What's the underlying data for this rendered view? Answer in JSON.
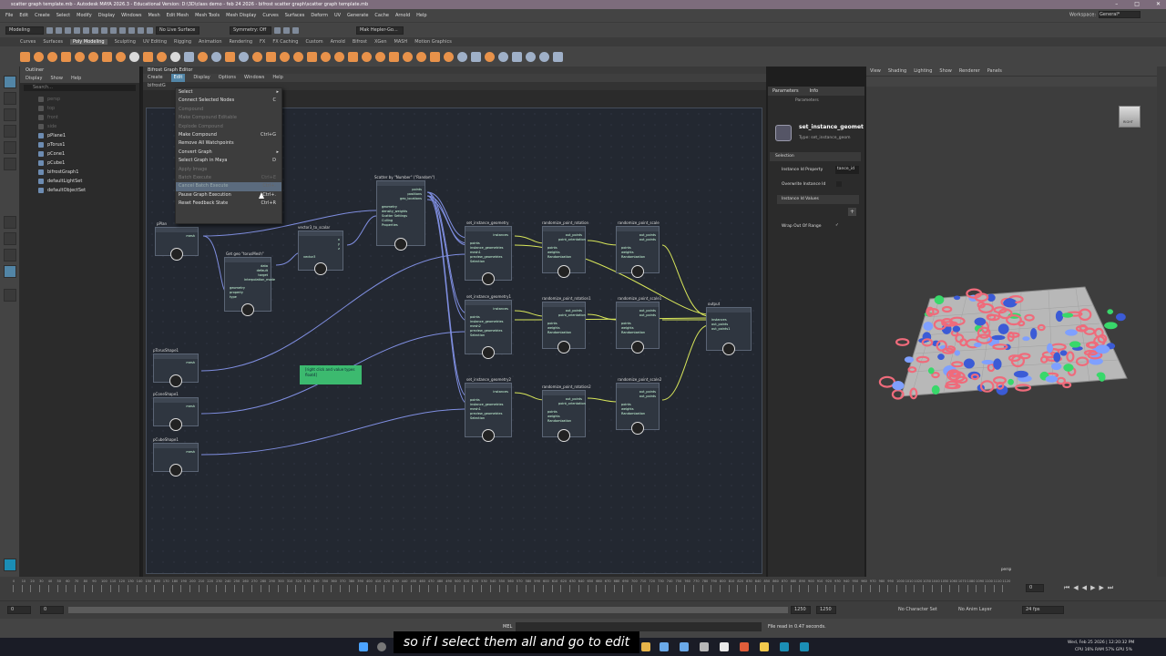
{
  "window": {
    "title": "scatter graph template.mb - Autodesk MAYA 2026.3 - Educational Version: D:\\3D\\class demo - feb 24 2026 - bifrost scatter graph\\scatter graph template.mb"
  },
  "menubar": [
    "File",
    "Edit",
    "Create",
    "Select",
    "Modify",
    "Display",
    "Windows",
    "Mesh",
    "Edit Mesh",
    "Mesh Tools",
    "Mesh Display",
    "Curves",
    "Surfaces",
    "Deform",
    "UV",
    "Generate",
    "Cache",
    "Arnold",
    "Help"
  ],
  "workspace": {
    "label": "Workspace:",
    "value": "General*"
  },
  "statusline": {
    "mode": "Modeling",
    "live_surface": "No Live Surface",
    "symmetry": "Symmetry: Off",
    "user": "Mak Hepler-Go..."
  },
  "shelf_tabs": [
    "Curves",
    "Surfaces",
    "Poly Modeling",
    "Sculpting",
    "UV Editing",
    "Rigging",
    "Animation",
    "Rendering",
    "FX",
    "FX Caching",
    "Custom",
    "Arnold",
    "Bifrost",
    "XGen",
    "MASH",
    "Motion Graphics"
  ],
  "shelf_active": "Poly Modeling",
  "outliner": {
    "title": "Outliner",
    "menu": [
      "Display",
      "Show",
      "Help"
    ],
    "search_placeholder": "Search...",
    "items": [
      {
        "label": "persp",
        "dim": true
      },
      {
        "label": "top",
        "dim": true
      },
      {
        "label": "front",
        "dim": true
      },
      {
        "label": "side",
        "dim": true
      },
      {
        "label": "pPlane1",
        "dim": false
      },
      {
        "label": "pTorus1",
        "dim": false
      },
      {
        "label": "pCone1",
        "dim": false
      },
      {
        "label": "pCube1",
        "dim": false
      },
      {
        "label": "bifrostGraph1",
        "dim": false
      },
      {
        "label": "defaultLightSet",
        "dim": false
      },
      {
        "label": "defaultObjectSet",
        "dim": false
      }
    ]
  },
  "bifrost": {
    "title": "Bifrost Graph Editor",
    "menu": [
      "Create",
      "Edit",
      "Display",
      "Options",
      "Windows",
      "Help"
    ],
    "tab": "bifrostG",
    "edit_menu": [
      {
        "label": "Select",
        "shortcut": "",
        "disabled": false,
        "arrow": true
      },
      {
        "label": "Connect Selected Nodes",
        "shortcut": "C",
        "disabled": false
      },
      {
        "label": "Compound",
        "shortcut": "",
        "disabled": true
      },
      {
        "label": "Make Compound Editable",
        "shortcut": "",
        "disabled": true
      },
      {
        "label": "Explode Compound",
        "shortcut": "",
        "disabled": true
      },
      {
        "label": "Make Compound",
        "shortcut": "Ctrl+G",
        "disabled": false
      },
      {
        "label": "Remove All Watchpoints",
        "shortcut": "",
        "disabled": false
      },
      {
        "label": "Convert Graph",
        "shortcut": "",
        "disabled": false,
        "arrow": true
      },
      {
        "label": "Select Graph in Maya",
        "shortcut": "D",
        "disabled": false
      },
      {
        "label": "Apply Image",
        "shortcut": "",
        "disabled": true
      },
      {
        "label": "Batch Execute",
        "shortcut": "Ctrl+E",
        "disabled": true
      },
      {
        "label": "Cancel Batch Execute",
        "shortcut": "Ctrl+.",
        "disabled": true,
        "highlight": true
      },
      {
        "label": "Pause Graph Execution",
        "shortcut": "Ctrl+.",
        "disabled": false
      },
      {
        "label": "Reset Feedback State",
        "shortcut": "Ctrl+R",
        "disabled": false
      }
    ],
    "note": "[right click and value types float4]",
    "nodes": {
      "pPlane": "pPlan",
      "get_geo": "Get geo \"torusMesh\"",
      "vector3_to_scalar": "vector3_to_scalar",
      "scatter": "Scatter by \"Number\" (\"Random\")",
      "sig0": "set_instance_geometry",
      "sig1": "set_instance_geometry1",
      "sig2": "set_instance_geometry2",
      "rot0": "randomize_point_rotation",
      "rot1": "randomize_point_rotation1",
      "rot2": "randomize_point_rotation2",
      "scl0": "randomize_point_scale",
      "scl1": "randomize_point_scale1",
      "scl2": "randomize_point_scale2",
      "torus": "pTorusShape1",
      "cone": "pConeShape1",
      "cube": "pCubeShape1",
      "output": "output"
    },
    "ports": {
      "mesh": "mesh",
      "scatter_out": [
        "points",
        "positions",
        "geo_locations"
      ],
      "scatter_in": [
        "geometry",
        "density_weights",
        "Scatter Settings",
        "Culling",
        "Properties"
      ],
      "getgeo_out": [
        "data",
        "default",
        "target",
        "interpolation_mode"
      ],
      "getgeo_in": [
        "geometry",
        "property",
        "type"
      ],
      "v3": [
        "x",
        "y",
        "z"
      ],
      "v3_in": "vector3",
      "sig_in": [
        "points",
        "instance_geometries",
        "mesh1",
        "preview_geometries",
        "Selection"
      ],
      "sig_in1": [
        "points",
        "instance_geometries",
        "mesh2",
        "preview_geometries",
        "Selection"
      ],
      "sig_in2": [
        "points",
        "instance_geometries",
        "mesh1",
        "preview_geometries",
        "Selection"
      ],
      "sig_out": "instances",
      "rot_out": [
        "out_points",
        "point_orientation"
      ],
      "rot_in": [
        "points",
        "weights",
        "Randomization"
      ],
      "scl_out": [
        "out_points",
        "out_points"
      ],
      "scl_in": [
        "points",
        "weights",
        "Randomization"
      ],
      "output_in": [
        "instances",
        "out_points",
        "out_points1"
      ]
    }
  },
  "parameters": {
    "tabs": [
      "Parameters",
      "Info"
    ],
    "sub": "Parameters",
    "title": "set_instance_geomet",
    "type": "Type: set_instance_geom",
    "section": "Selection",
    "instance_id_property_label": "Instance Id Property",
    "instance_id_property_value": "tance_id",
    "overwrite_label": "Overwrite Instance Id",
    "values_label": "Instance Id Values",
    "wrap_label": "Wrap Out Of Range"
  },
  "viewport": {
    "menu": [
      "View",
      "Shading",
      "Lighting",
      "Show",
      "Renderer",
      "Panels"
    ],
    "camera": "persp",
    "cube_label": "RIGHT"
  },
  "timeline": {
    "start": "0",
    "end": "0",
    "range_start": "0",
    "range_end": "1250",
    "range_end2": "1250",
    "character_set": "No Character Set",
    "anim_layer": "No Anim Layer",
    "fps": "24 fps",
    "ticks": [
      "0",
      "10",
      "20",
      "30",
      "40",
      "50",
      "60",
      "70",
      "80",
      "90",
      "100",
      "110",
      "120",
      "130",
      "140",
      "150",
      "160",
      "170",
      "180",
      "190",
      "200",
      "210",
      "220",
      "230",
      "240",
      "250",
      "260",
      "270",
      "280",
      "290",
      "300",
      "310",
      "320",
      "330",
      "340",
      "350",
      "360",
      "370",
      "380",
      "390",
      "400",
      "410",
      "420",
      "430",
      "440",
      "450",
      "460",
      "470",
      "480",
      "490",
      "500",
      "510",
      "520",
      "530",
      "540",
      "550",
      "560",
      "570",
      "580",
      "590",
      "600",
      "610",
      "620",
      "630",
      "640",
      "650",
      "660",
      "670",
      "680",
      "690",
      "700",
      "710",
      "720",
      "730",
      "740",
      "750",
      "760",
      "770",
      "780",
      "790",
      "800",
      "810",
      "820",
      "830",
      "840",
      "850",
      "860",
      "870",
      "880",
      "890",
      "900",
      "910",
      "920",
      "930",
      "940",
      "950",
      "960",
      "970",
      "980",
      "990",
      "1000",
      "1010",
      "1020",
      "1030",
      "1040",
      "1050",
      "1060",
      "1070",
      "1080",
      "1090",
      "1100",
      "1110",
      "1120"
    ]
  },
  "cmdline": {
    "lang": "MEL",
    "status": "File read in 0.47 seconds."
  },
  "taskbar": {
    "date": "Wed, Feb 25 2026 | 12:20:32 PM",
    "stats": "CPU 16% RAM 57% GPU 5%"
  },
  "subtitle": "so if I select them all and go to edit",
  "colors": {
    "accent": "#5285a6",
    "note": "#3cba6f",
    "wire": "#7f8ee0",
    "wire_yellow": "#d8e65a"
  }
}
